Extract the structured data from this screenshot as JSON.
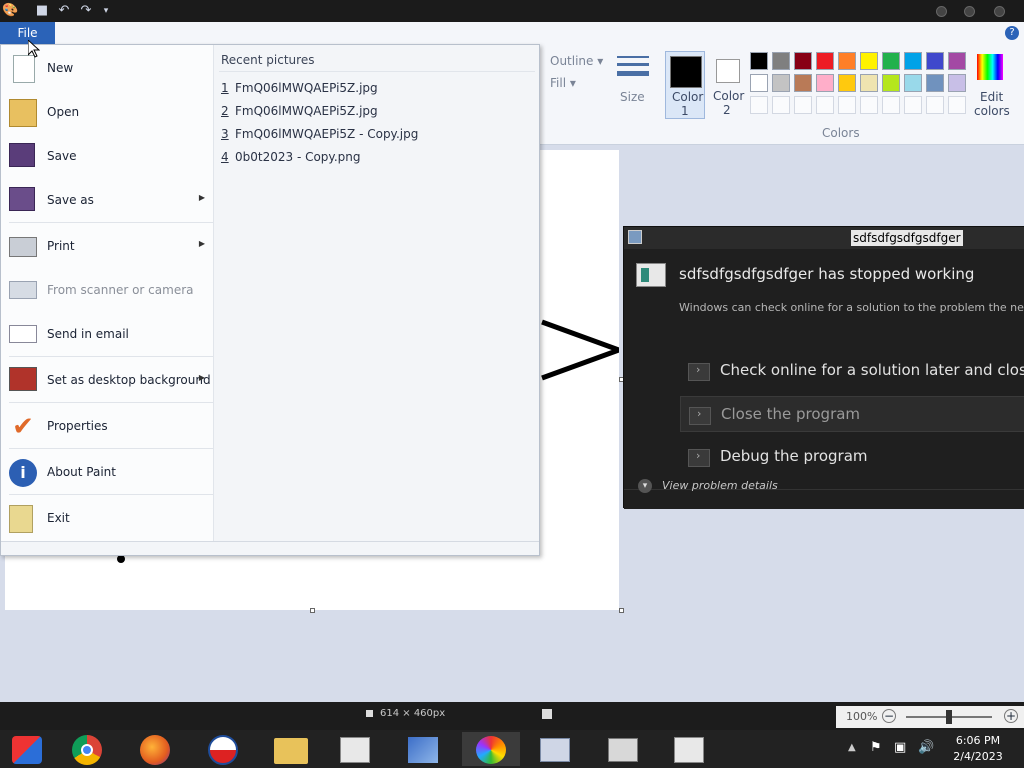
{
  "ribbon": {
    "file_tab": "File",
    "outline_label": "Outline",
    "fill_label": "Fill",
    "size_label": "Size",
    "color1_label": "Color\n1",
    "color1_l1": "Color",
    "color1_l2": "1",
    "color2_l1": "Color",
    "color2_l2": "2",
    "colors_label": "Colors",
    "edit_colors_l1": "Edit",
    "edit_colors_l2": "colors",
    "palette_row1": [
      "#000000",
      "#7f7f7f",
      "#880015",
      "#ed1c24",
      "#ff7f27",
      "#fff200",
      "#22b14c",
      "#00a2e8",
      "#3f48cc",
      "#a349a4"
    ],
    "palette_row2": [
      "#ffffff",
      "#c3c3c3",
      "#b97a57",
      "#ffaec9",
      "#ffc90e",
      "#efe4b0",
      "#b5e61d",
      "#99d9ea",
      "#7092be",
      "#c8bfe7"
    ]
  },
  "file_menu": {
    "items": [
      {
        "label": "New"
      },
      {
        "label": "Open"
      },
      {
        "label": "Save"
      },
      {
        "label": "Save as"
      },
      {
        "label": "Print"
      },
      {
        "label": "From scanner or camera"
      },
      {
        "label": "Send in email"
      },
      {
        "label": "Set as desktop background"
      },
      {
        "label": "Properties"
      },
      {
        "label": "About Paint"
      },
      {
        "label": "Exit"
      }
    ],
    "recent_title": "Recent pictures",
    "recent": [
      {
        "num": "1",
        "name": "FmQ06lMWQAEPi5Z.jpg"
      },
      {
        "num": "2",
        "name": "FmQ06lMWQAEPi5Z.jpg"
      },
      {
        "num": "3",
        "name": "FmQ06lMWQAEPi5Z - Copy.jpg"
      },
      {
        "num": "4",
        "name": "0b0t2023 - Copy.png"
      }
    ]
  },
  "dialog": {
    "title": "sdfsdfgsdfgsdfger",
    "heading": "sdfsdfgsdfgsdfger has stopped working",
    "subtext": "Windows can check online for a solution to the problem the next tim",
    "options": [
      {
        "label": "Check online for a solution later and close"
      },
      {
        "label": "Close the program"
      },
      {
        "label": "Debug the program"
      }
    ],
    "details": "View problem details"
  },
  "statusbar": {
    "dimensions": "614 × 460px",
    "zoom": "100%"
  },
  "taskbar": {
    "time": "6:06 PM",
    "date": "2/4/2023"
  },
  "colors": {
    "accent": "#2b63b8",
    "dialog_bg": "#1f1f1f"
  }
}
